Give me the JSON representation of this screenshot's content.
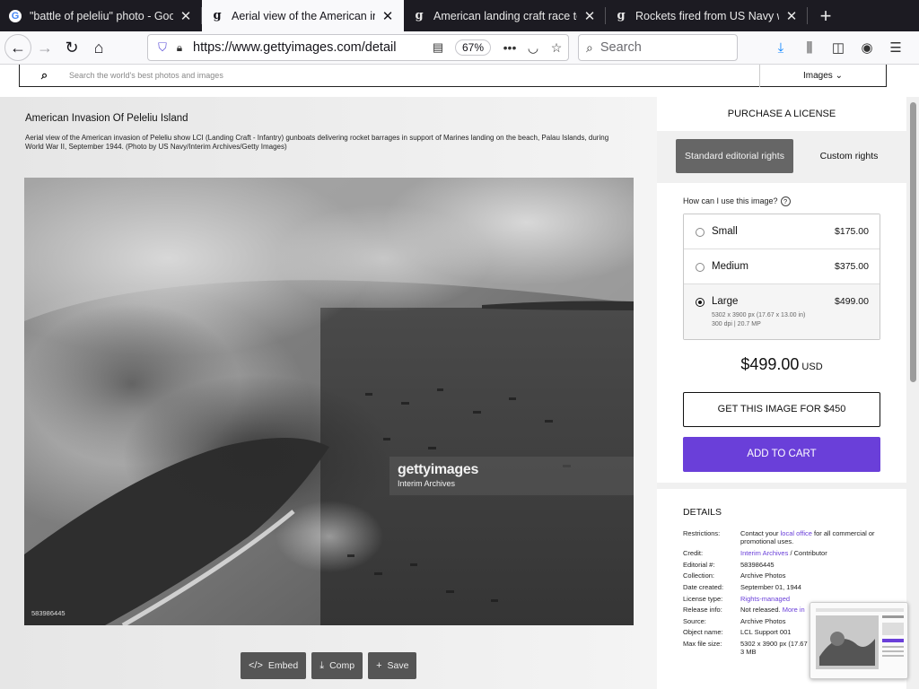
{
  "browser": {
    "tabs": [
      {
        "title": "\"battle of peleliu\" photo - Goog",
        "favicon": "google-g-icon",
        "active": false
      },
      {
        "title": "Aerial view of the American inva",
        "favicon": "gettyimages-g-icon",
        "active": true
      },
      {
        "title": "American landing craft race tow",
        "favicon": "gettyimages-g-icon",
        "active": false
      },
      {
        "title": "Rockets fired from US Navy wa",
        "favicon": "gettyimages-g-icon",
        "active": false
      }
    ],
    "url": "https://www.gettyimages.com/detail",
    "zoom": "67%",
    "search_placeholder": "Search"
  },
  "site": {
    "search_placeholder": "Search the world's best photos and images",
    "search_type": "Images"
  },
  "image": {
    "title": "American Invasion Of Peleliu Island",
    "caption": "Aerial view of the American invasion of Peleliu show LCI (Landing Craft - Infantry) gunboats delivering rocket barrages in support of Marines landing on the beach, Palau Islands, during World War II, September 1944. (Photo by US Navy/Interim Archives/Getty Images)",
    "watermark_logo": "gettyimages",
    "watermark_credit": "Interim Archives",
    "id_label": "583986445",
    "actions": [
      {
        "label": "Embed",
        "icon": "code-icon"
      },
      {
        "label": "Comp",
        "icon": "download-icon"
      },
      {
        "label": "Save",
        "icon": "plus-icon"
      }
    ]
  },
  "purchase": {
    "heading": "PURCHASE A LICENSE",
    "tabs": {
      "standard": "Standard editorial rights",
      "custom": "Custom rights"
    },
    "question": "How can I use this image?",
    "sizes": [
      {
        "name": "Small",
        "price": "$175.00",
        "selected": false
      },
      {
        "name": "Medium",
        "price": "$375.00",
        "selected": false
      },
      {
        "name": "Large",
        "price": "$499.00",
        "selected": true,
        "detail_1": "5302 x 3900 px (17.67 x 13.00 in)",
        "detail_2": "300 dpi | 20.7 MP"
      }
    ],
    "price": "$499.00",
    "currency": "USD",
    "get_button": "GET THIS IMAGE FOR $450",
    "cart_button": "ADD TO CART",
    "accent_color": "#6a3fd9"
  },
  "details": {
    "heading": "DETAILS",
    "restrictions_pre": "Contact your",
    "restrictions_link": "local office",
    "restrictions_post": "for all commercial or promotional uses.",
    "credit_link": "Interim Archives",
    "credit_suffix": "/ Contributor",
    "rows": [
      {
        "label": "Restrictions:"
      },
      {
        "label": "Credit:"
      },
      {
        "label": "Editorial #:",
        "value": "583986445"
      },
      {
        "label": "Collection:",
        "value": "Archive Photos"
      },
      {
        "label": "Date created:",
        "value": "September 01, 1944"
      },
      {
        "label": "License type:",
        "value": "Rights-managed"
      },
      {
        "label": "Release info:",
        "value": "Not released.",
        "link": "More in"
      },
      {
        "label": "Source:",
        "value": "Archive Photos"
      },
      {
        "label": "Object name:",
        "value": "LCL Support 001"
      },
      {
        "label": "Max file size:",
        "value": "5302 x 3900 px (17.67",
        "value_2": "3 MB"
      }
    ]
  }
}
